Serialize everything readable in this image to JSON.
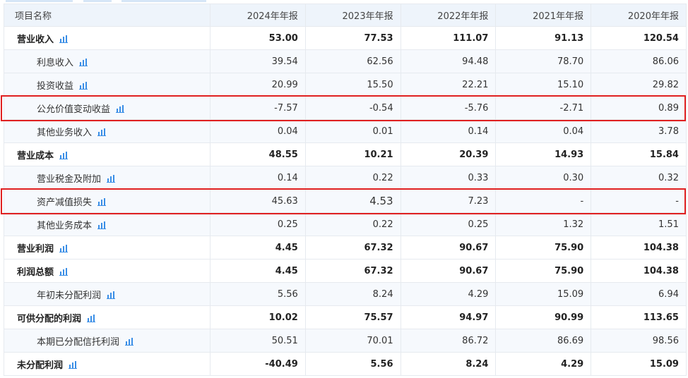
{
  "colors": {
    "highlight": "#e02020",
    "icon": "#3a8ee6",
    "header_bg": "#eef4fb"
  },
  "table": {
    "headers": [
      "项目名称",
      "2024年年报",
      "2023年年报",
      "2022年年报",
      "2021年年报",
      "2020年年报"
    ],
    "rows": [
      {
        "name": "营业收入",
        "type": "bold",
        "icon": "bar-chart-icon",
        "values": [
          "53.00",
          "77.53",
          "111.07",
          "91.13",
          "120.54"
        ]
      },
      {
        "name": "利息收入",
        "type": "sub",
        "icon": "bar-chart-icon",
        "values": [
          "39.54",
          "62.56",
          "94.48",
          "78.70",
          "86.06"
        ]
      },
      {
        "name": "投资收益",
        "type": "sub",
        "icon": "bar-chart-icon",
        "values": [
          "20.99",
          "15.50",
          "22.21",
          "15.10",
          "29.82"
        ]
      },
      {
        "name": "公允价值变动收益",
        "type": "sub",
        "icon": "bar-chart-icon",
        "highlighted": true,
        "values": [
          "-7.57",
          "-0.54",
          "-5.76",
          "-2.71",
          "0.89"
        ]
      },
      {
        "name": "其他业务收入",
        "type": "sub",
        "icon": "bar-chart-icon",
        "values": [
          "0.04",
          "0.01",
          "0.14",
          "0.04",
          "3.78"
        ]
      },
      {
        "name": "营业成本",
        "type": "bold",
        "icon": "bar-chart-icon",
        "values": [
          "48.55",
          "10.21",
          "20.39",
          "14.93",
          "15.84"
        ]
      },
      {
        "name": "营业税金及附加",
        "type": "sub",
        "icon": "bar-chart-icon",
        "values": [
          "0.14",
          "0.22",
          "0.33",
          "0.30",
          "0.32"
        ]
      },
      {
        "name": "资产减值损失",
        "type": "sub",
        "icon": "bar-chart-icon",
        "highlighted": true,
        "values": [
          "45.63",
          "4.53",
          "7.23",
          "-",
          "-"
        ]
      },
      {
        "name": "其他业务成本",
        "type": "sub",
        "icon": "bar-chart-icon",
        "values": [
          "0.25",
          "0.22",
          "0.25",
          "1.32",
          "1.51"
        ]
      },
      {
        "name": "营业利润",
        "type": "bold",
        "icon": "bar-chart-icon",
        "values": [
          "4.45",
          "67.32",
          "90.67",
          "75.90",
          "104.38"
        ]
      },
      {
        "name": "利润总额",
        "type": "bold",
        "icon": "bar-chart-icon",
        "values": [
          "4.45",
          "67.32",
          "90.67",
          "75.90",
          "104.38"
        ]
      },
      {
        "name": "年初未分配利润",
        "type": "sub",
        "icon": "bar-chart-icon",
        "values": [
          "5.56",
          "8.24",
          "4.29",
          "15.09",
          "6.94"
        ]
      },
      {
        "name": "可供分配的利润",
        "type": "bold",
        "icon": "bar-chart-icon",
        "values": [
          "10.02",
          "75.57",
          "94.97",
          "90.99",
          "113.65"
        ]
      },
      {
        "name": "本期已分配信托利润",
        "type": "sub",
        "icon": "bar-chart-icon",
        "values": [
          "50.51",
          "70.01",
          "86.72",
          "86.69",
          "98.56"
        ]
      },
      {
        "name": "未分配利润",
        "type": "bold",
        "icon": "bar-chart-icon",
        "values": [
          "-40.49",
          "5.56",
          "8.24",
          "4.29",
          "15.09"
        ]
      }
    ]
  }
}
